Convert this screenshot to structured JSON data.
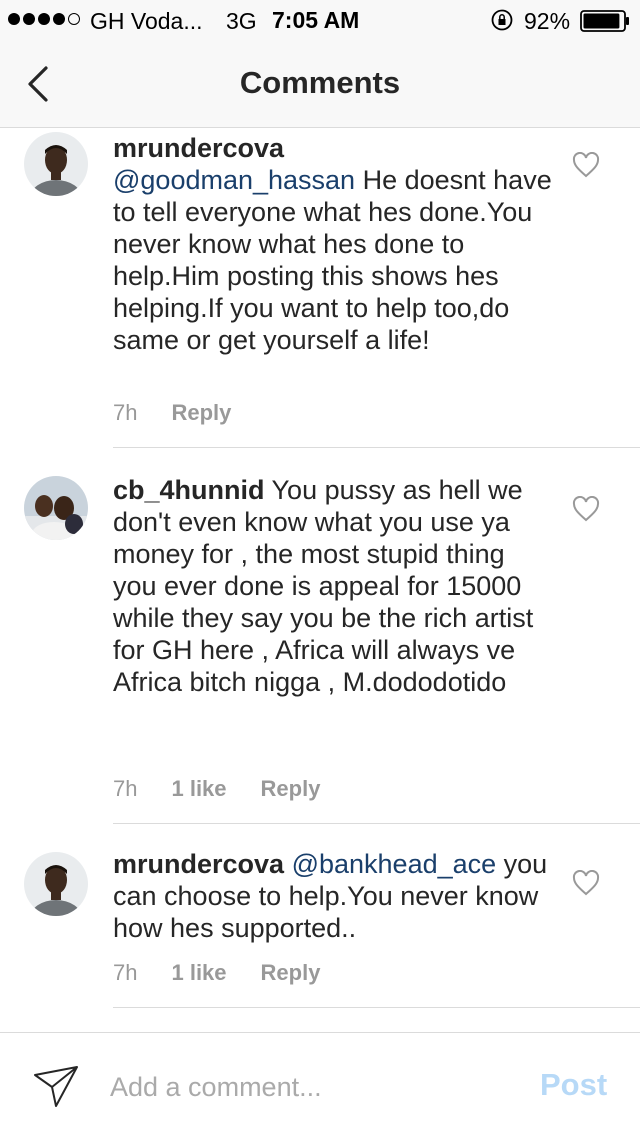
{
  "status_bar": {
    "carrier": "GH Voda...",
    "network": "3G",
    "time": "7:05 AM",
    "battery_percent": "92%",
    "battery_level": 0.92,
    "signal_bars": 4,
    "icons": [
      "signal-dots-icon",
      "orientation-lock-icon",
      "battery-icon"
    ]
  },
  "nav": {
    "title": "Comments",
    "back_icon": "back-chevron-icon"
  },
  "comments": [
    {
      "username": "mrundercova",
      "mention": "@goodman_hassan",
      "text": " He doesnt have to tell everyone what hes done.You never know what hes done to help.Him posting this shows hes helping.If you want to help too,do same or get yourself a life!",
      "time": "7h",
      "likes": "",
      "reply_label": "Reply",
      "icon": "heart-icon"
    },
    {
      "username": "cb_4hunnid",
      "mention": "",
      "text": " You pussy as hell we don't even know what you use ya money for , the most stupid thing you ever done is appeal for 15000 while they say you be the rich artist for GH here , Africa will always ve Africa bitch nigga , M.dododotido",
      "time": "7h",
      "likes": "1 like",
      "reply_label": "Reply",
      "icon": "heart-icon"
    },
    {
      "username": "mrundercova",
      "mention": "@bankhead_ace",
      "text": " you can choose to help.You never know how hes supported..",
      "time": "7h",
      "likes": "1 like",
      "reply_label": "Reply",
      "icon": "heart-icon"
    }
  ],
  "input_bar": {
    "placeholder": "Add a comment...",
    "value": "",
    "post_label": "Post",
    "send_icon": "paper-plane-icon"
  },
  "colors": {
    "mention": "#1a3f6b",
    "post_disabled": "#b7d9f7",
    "meta": "#999999",
    "divider": "#dbdbdb"
  }
}
